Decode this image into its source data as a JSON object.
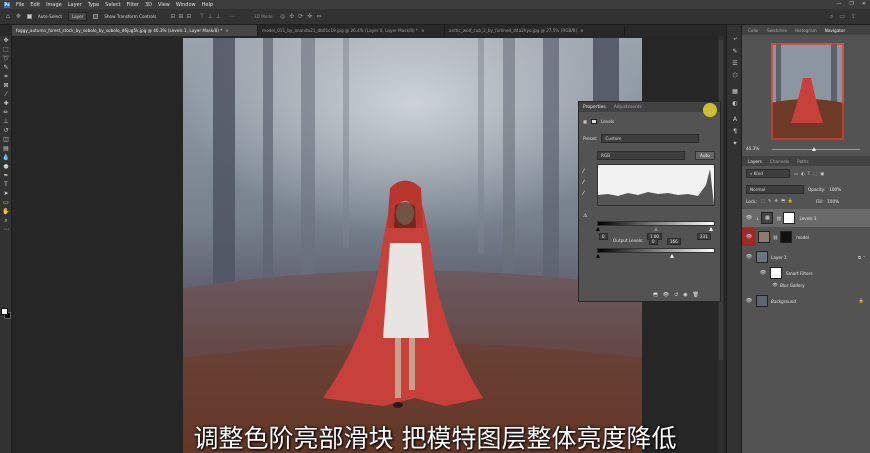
{
  "menubar": {
    "logo": "Ps",
    "items": [
      "File",
      "Edit",
      "Image",
      "Layer",
      "Type",
      "Select",
      "Filter",
      "3D",
      "View",
      "Window",
      "Help"
    ],
    "window_controls": [
      "—",
      "❐",
      "✕"
    ]
  },
  "options": {
    "auto_select_label": "Auto-Select",
    "auto_select_checked": true,
    "target_value": "Layer",
    "transform_controls_label": "Show Transform Controls",
    "mode_3d_label": "3D Mode:"
  },
  "doc_tabs": [
    {
      "label": "foggy_autumn_forest_stock_by_sobolo_by_sobolo_d6jug5k.jpg @ 40.3% (Levels 1, Layer Mask/8) *",
      "active": true
    },
    {
      "label": "model_011_by_ananda21_db01c19.jpg @ 26.4% (Layer 0, Layer Mask/8) *",
      "active": false
    },
    {
      "label": "arctic_wolf_cub_2_by_furlined_d4a2hyo.jpg @ 27.5% (RGB/8)",
      "active": false
    }
  ],
  "properties": {
    "tab_properties": "Properties",
    "tab_adjustments": "Adjustments",
    "adjustment_name": "Levels",
    "preset_label": "Preset:",
    "preset_value": "Custom",
    "channel_value": "RGB",
    "auto_label": "Auto",
    "input_black": "0",
    "input_gamma": "1.00",
    "input_white": "231",
    "output_label": "Output Levels:",
    "output_black": "0",
    "output_white": "166"
  },
  "right_panels": {
    "top_tabs": [
      "Color",
      "Swatches",
      "Histogram",
      "Navigator"
    ],
    "active_top_tab": "Navigator",
    "zoom": "40.3%",
    "layer_tabs": [
      "Layers",
      "Channels",
      "Paths"
    ],
    "active_layer_tab": "Layers",
    "kind_label": "Kind",
    "blend_mode": "Normal",
    "opacity_label": "Opacity:",
    "opacity_value": "100%",
    "lock_label": "Lock:",
    "fill_label": "Fill:",
    "fill_value": "100%",
    "layers": [
      {
        "name": "Levels 1",
        "type": "adjustment",
        "selected": true
      },
      {
        "name": "model",
        "type": "image",
        "selected": false
      },
      {
        "name": "Layer 1",
        "type": "image",
        "selected": false
      },
      {
        "name": "Smart Filters",
        "type": "filter-group",
        "selected": false
      },
      {
        "name": "Blur Gallery",
        "type": "filter",
        "selected": false
      },
      {
        "name": "Background",
        "type": "background",
        "selected": false
      }
    ]
  },
  "subtitle": "调整色阶亮部滑块 把模特图层整体亮度降低",
  "colors": {
    "accent_blue": "#2d6dd8",
    "cloak_red": "#c8403a",
    "panel_gray": "#535353"
  }
}
